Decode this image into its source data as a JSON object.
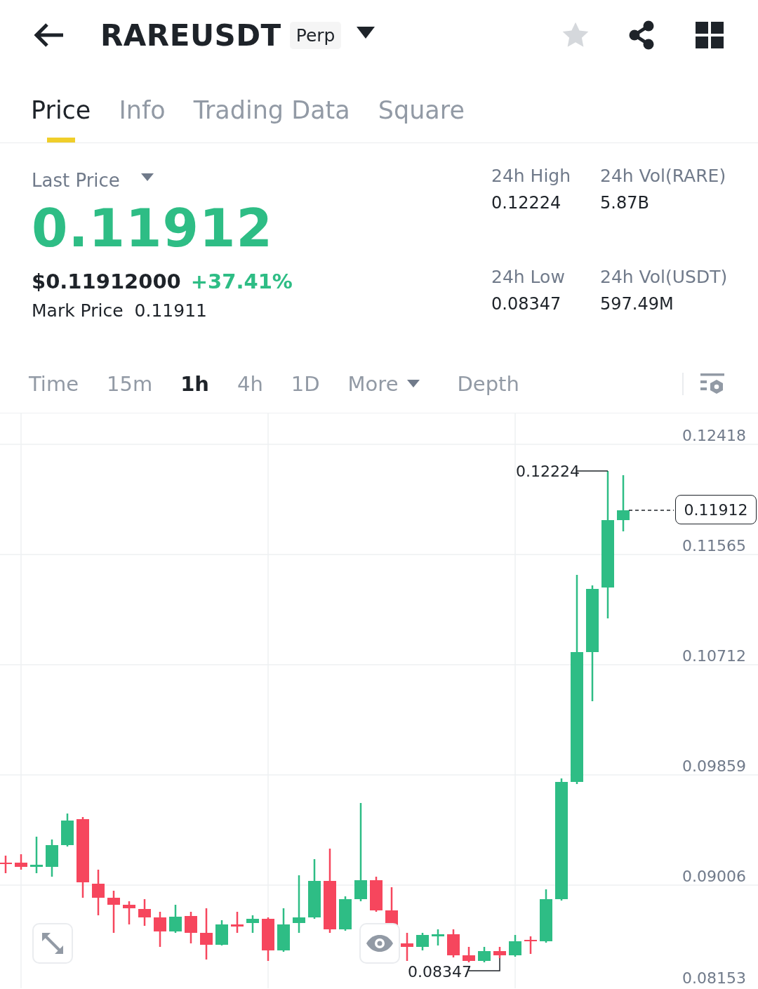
{
  "header": {
    "title": "RAREUSDT",
    "badge": "Perp"
  },
  "tabs": [
    {
      "label": "Price",
      "selected": true
    },
    {
      "label": "Info",
      "selected": false
    },
    {
      "label": "Trading Data",
      "selected": false
    },
    {
      "label": "Square",
      "selected": false
    }
  ],
  "ticker": {
    "label": "Last Price",
    "price": "0.11912",
    "usd_price": "$0.11912000",
    "change": "+37.41%",
    "mark_price_label": "Mark Price",
    "mark_price": "0.11911",
    "stats": [
      {
        "label": "24h High",
        "value": "0.12224"
      },
      {
        "label": "24h Vol(RARE)",
        "value": "5.87B"
      },
      {
        "label": "24h Low",
        "value": "0.08347"
      },
      {
        "label": "24h Vol(USDT)",
        "value": "597.49M"
      }
    ]
  },
  "intervals": [
    {
      "label": "Time",
      "kind": "interval",
      "selected": false
    },
    {
      "label": "15m",
      "kind": "interval",
      "selected": false
    },
    {
      "label": "1h",
      "kind": "interval",
      "selected": true
    },
    {
      "label": "4h",
      "kind": "interval",
      "selected": false
    },
    {
      "label": "1D",
      "kind": "interval",
      "selected": false
    },
    {
      "label": "More",
      "kind": "menu",
      "selected": false
    },
    {
      "label": "Depth",
      "kind": "view",
      "selected": false
    }
  ],
  "chart": {
    "y_labels": [
      "0.12418",
      "0.11565",
      "0.10712",
      "0.09859",
      "0.09006",
      "0.08153"
    ],
    "high_marker": "0.12224",
    "low_marker": "0.08347",
    "current_price": "0.11912"
  }
}
